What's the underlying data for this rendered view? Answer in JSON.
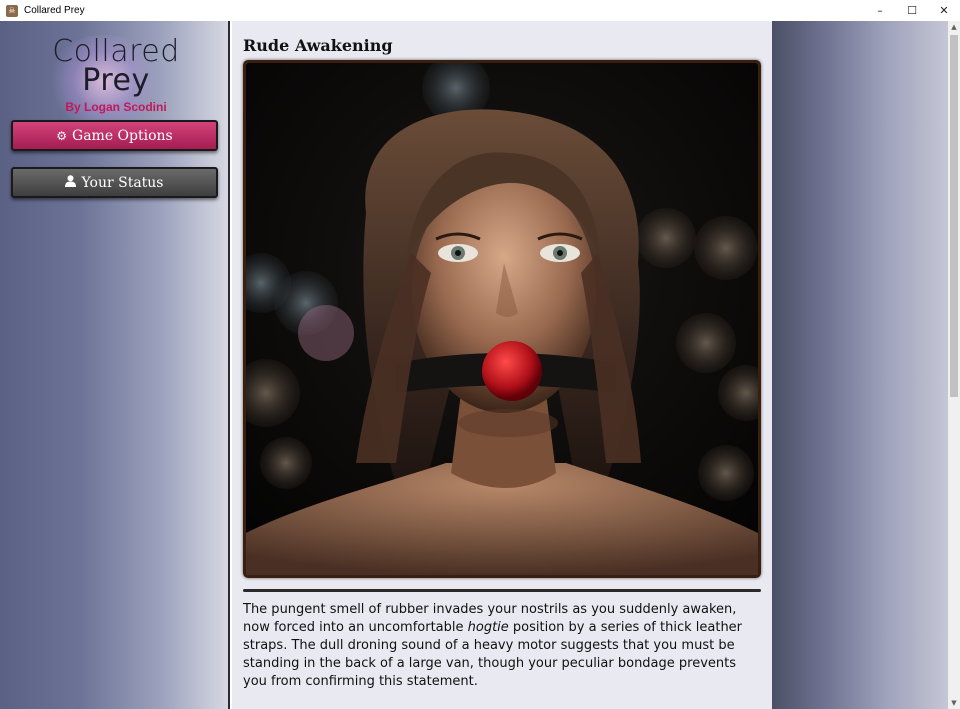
{
  "window": {
    "title": "Collared Prey",
    "app_icon": "game-app-icon",
    "controls": {
      "minimize": "–",
      "maximize": "☐",
      "close": "✕"
    }
  },
  "sidebar": {
    "logo": {
      "line1": "Collared",
      "line2": "Prey",
      "byline": "By Logan Scodini"
    },
    "buttons": [
      {
        "label": "Game Options",
        "icon": "gear-icon",
        "glyph": "⚙"
      },
      {
        "label": "Your Status",
        "icon": "user-icon",
        "glyph": "👤"
      }
    ]
  },
  "main": {
    "title": "Rude Awakening",
    "paragraph": {
      "before_em": "The pungent smell of rubber invades your nostrils as you suddenly awaken, now forced into an uncomfortable ",
      "em": "hogtie",
      "after_em": " position by a series of thick leather straps. The dull droning sound of a heavy motor suggests that you must be standing in the back of a large van, though your peculiar bondage prevents you from confirming this statement."
    }
  },
  "scrollbar": {
    "up_glyph": "▲",
    "down_glyph": "▼"
  },
  "colors": {
    "accent": "#c2185b",
    "options_button": "#b8285e",
    "status_button": "#505050",
    "frame": "#3a1e10"
  }
}
